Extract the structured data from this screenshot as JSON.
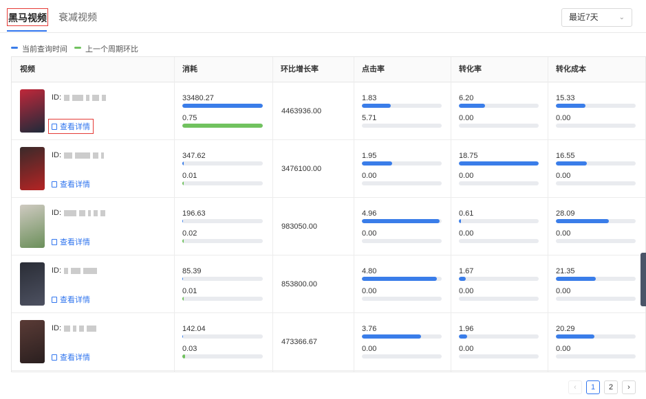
{
  "tabs": [
    {
      "label": "黑马视频",
      "active": true
    },
    {
      "label": "衰减视频",
      "active": false
    }
  ],
  "period_select": {
    "value": "最近7天"
  },
  "legend": [
    {
      "label": "当前查询时间",
      "color": "#3a7de9"
    },
    {
      "label": "上一个周期环比",
      "color": "#71c25f"
    }
  ],
  "columns": [
    "视频",
    "消耗",
    "环比增长率",
    "点击率",
    "转化率",
    "转化成本"
  ],
  "detail_label": "查看详情",
  "id_prefix": "ID:",
  "rows": [
    {
      "thumb_colors": [
        "#c0283a",
        "#1e2a3a"
      ],
      "consume": {
        "current": "33480.27",
        "previous": "0.75",
        "current_fill": 1.0,
        "previous_fill": 1.0
      },
      "growth": "4463936.00",
      "ctr": {
        "current": "1.83",
        "previous": "5.71",
        "current_fill": 0.36,
        "previous_fill": 0.0
      },
      "cvr": {
        "current": "6.20",
        "previous": "0.00",
        "current_fill": 0.33,
        "previous_fill": 0.0
      },
      "cost": {
        "current": "15.33",
        "previous": "0.00",
        "current_fill": 0.37,
        "previous_fill": 0.0
      }
    },
    {
      "thumb_colors": [
        "#3a2a2a",
        "#b52424"
      ],
      "consume": {
        "current": "347.62",
        "previous": "0.01",
        "current_fill": 0.02,
        "previous_fill": 0.02
      },
      "growth": "3476100.00",
      "ctr": {
        "current": "1.95",
        "previous": "0.00",
        "current_fill": 0.38,
        "previous_fill": 0.0
      },
      "cvr": {
        "current": "18.75",
        "previous": "0.00",
        "current_fill": 1.0,
        "previous_fill": 0.0
      },
      "cost": {
        "current": "16.55",
        "previous": "0.00",
        "current_fill": 0.39,
        "previous_fill": 0.0
      }
    },
    {
      "thumb_colors": [
        "#cfcac1",
        "#6b8f5a"
      ],
      "consume": {
        "current": "196.63",
        "previous": "0.02",
        "current_fill": 0.01,
        "previous_fill": 0.02
      },
      "growth": "983050.00",
      "ctr": {
        "current": "4.96",
        "previous": "0.00",
        "current_fill": 0.97,
        "previous_fill": 0.0
      },
      "cvr": {
        "current": "0.61",
        "previous": "0.00",
        "current_fill": 0.03,
        "previous_fill": 0.0
      },
      "cost": {
        "current": "28.09",
        "previous": "0.00",
        "current_fill": 0.66,
        "previous_fill": 0.0
      }
    },
    {
      "thumb_colors": [
        "#2a2d36",
        "#4d5161"
      ],
      "consume": {
        "current": "85.39",
        "previous": "0.01",
        "current_fill": 0.01,
        "previous_fill": 0.02
      },
      "growth": "853800.00",
      "ctr": {
        "current": "4.80",
        "previous": "0.00",
        "current_fill": 0.94,
        "previous_fill": 0.0
      },
      "cvr": {
        "current": "1.67",
        "previous": "0.00",
        "current_fill": 0.09,
        "previous_fill": 0.0
      },
      "cost": {
        "current": "21.35",
        "previous": "0.00",
        "current_fill": 0.5,
        "previous_fill": 0.0
      }
    },
    {
      "thumb_colors": [
        "#5a3b36",
        "#2a1f1f"
      ],
      "consume": {
        "current": "142.04",
        "previous": "0.03",
        "current_fill": 0.01,
        "previous_fill": 0.03
      },
      "growth": "473366.67",
      "ctr": {
        "current": "3.76",
        "previous": "0.00",
        "current_fill": 0.74,
        "previous_fill": 0.0
      },
      "cvr": {
        "current": "1.96",
        "previous": "0.00",
        "current_fill": 0.1,
        "previous_fill": 0.0
      },
      "cost": {
        "current": "20.29",
        "previous": "0.00",
        "current_fill": 0.48,
        "previous_fill": 0.0
      }
    }
  ],
  "pagination": {
    "pages": [
      "1",
      "2"
    ],
    "current": "1",
    "prev": "‹",
    "next": "›"
  }
}
